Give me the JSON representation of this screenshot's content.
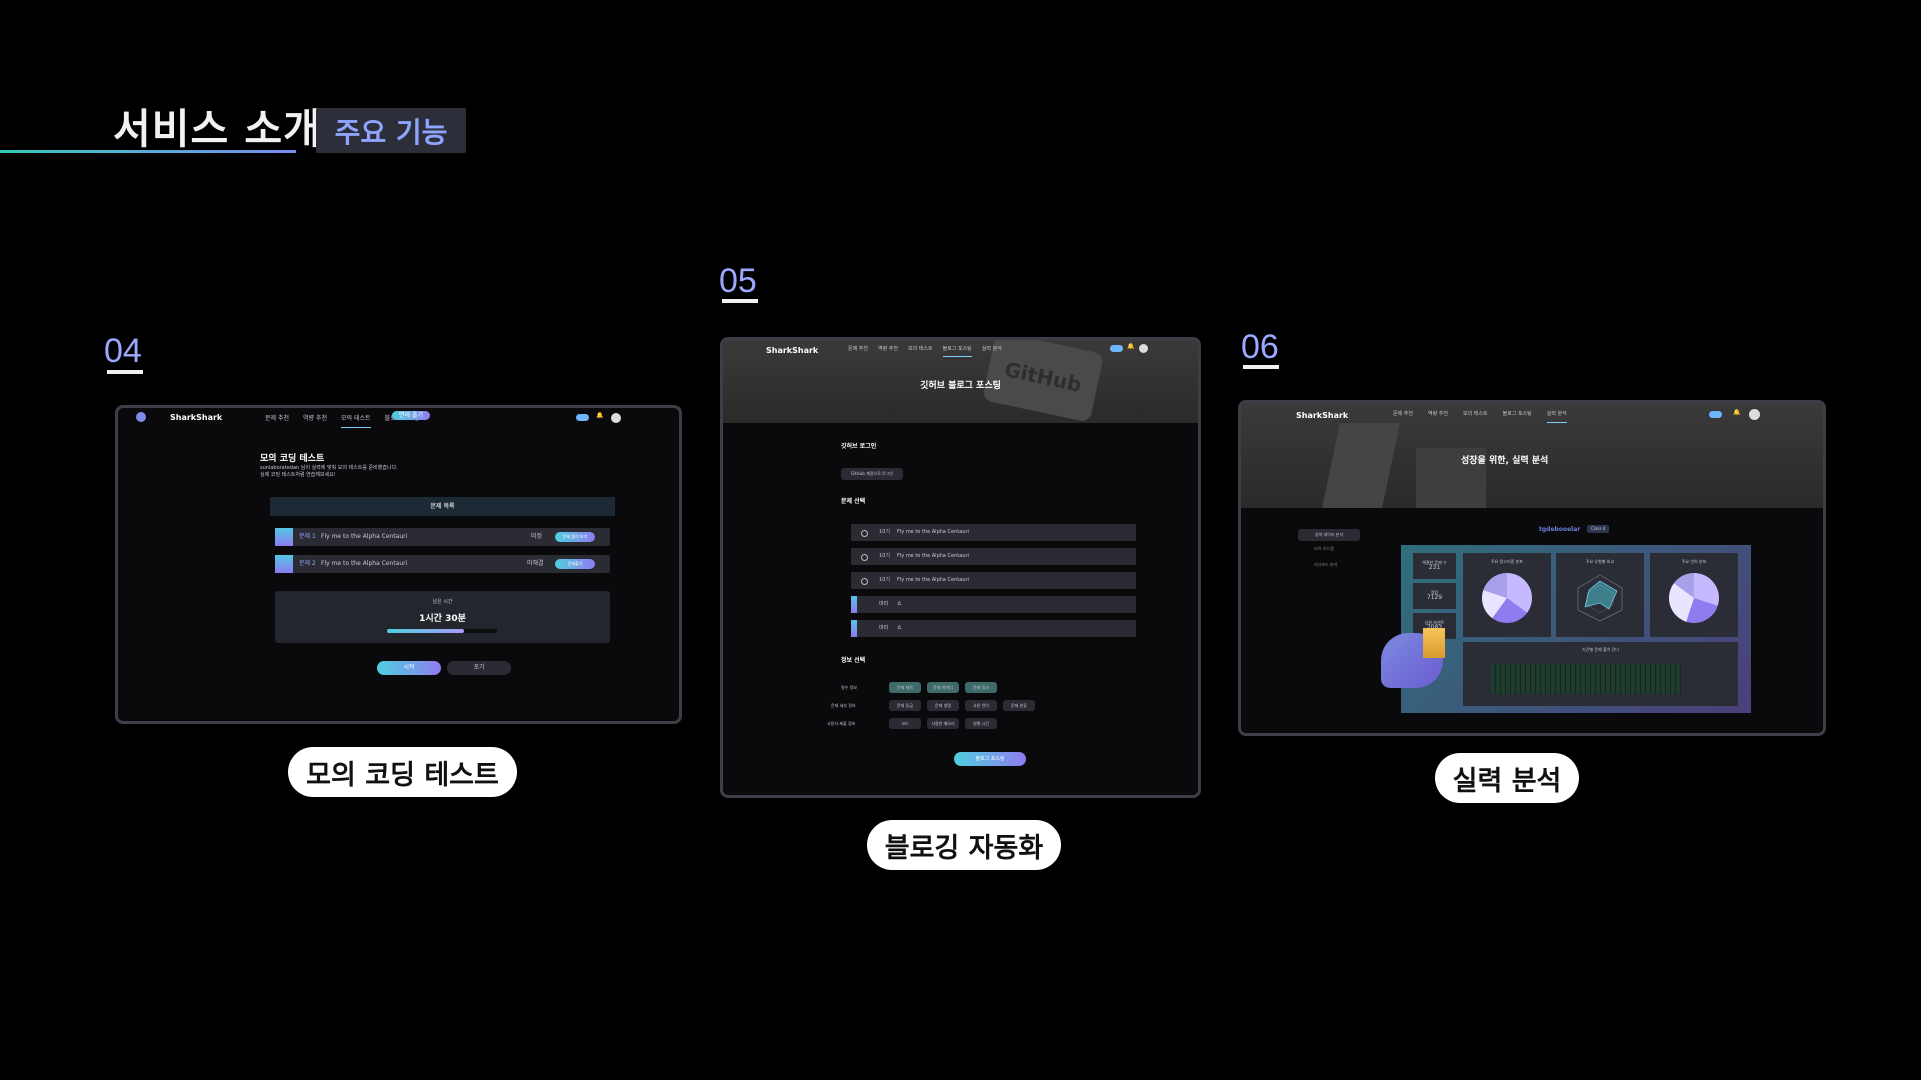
{
  "header": {
    "title": "서비스 소개",
    "badge": "주요 기능"
  },
  "colors": {
    "accent": "#9aa8ff",
    "badge_bg": "#2c2f3a",
    "frame_border": "#3d3f48"
  },
  "features": [
    {
      "number": "04",
      "caption": "모의 코딩 테스트",
      "shot": {
        "logo": "SharkShark",
        "nav": [
          "문제 추천",
          "역량 추천",
          "모의 테스트",
          "블로그 포스팅"
        ],
        "nav_button": "면제 풀기",
        "heading": "모의 코딩 테스트",
        "desc1": "sunlaboratedan 님이 실력에 맞춰 모의 테스트를 준비했습니다.",
        "desc2": "실제 코딩 테스트처럼 연습해보세요!",
        "section": "문제 목록",
        "problems": [
          {
            "label": "문제 1",
            "title": "Fly me to the Alpha Centauri",
            "tag": "미정",
            "button": "문제 풀이 보기"
          },
          {
            "label": "문제 2",
            "title": "Fly me to the Alpha Centauri",
            "tag": "미해결",
            "button": "문제풀기"
          }
        ],
        "timer_label": "남은 시간",
        "timer": "1시간 30분",
        "progress": 0.7,
        "buttons": [
          "시작",
          "포기"
        ]
      }
    },
    {
      "number": "05",
      "caption": "블로깅 자동화",
      "shot": {
        "logo": "SharkShark",
        "nav": [
          "문제 추천",
          "역량 추천",
          "모의 테스트",
          "블로그 포스팅",
          "실력 분석"
        ],
        "hero_title": "깃허브 블로그 포스팅",
        "hero_watermark": "GitHub",
        "login_title": "깃허브 로그인",
        "login_button": "GitHub 계정으로 로그인",
        "select_title": "문제 선택",
        "problems": [
          {
            "tier": "10기",
            "title": "Fly me to the Alpha Centauri"
          },
          {
            "tier": "10기",
            "title": "Fly me to the Alpha Centauri"
          },
          {
            "tier": "10기",
            "title": "Fly me to the Alpha Centauri"
          },
          {
            "tier": "마리",
            "title": "쇼"
          },
          {
            "tier": "마리",
            "title": "쇼"
          }
        ],
        "info_title": "정보 선택",
        "option_rows": [
          {
            "label": "필수 정보",
            "options": [
              "문제 제목",
              "문제 아이디",
              "문제 링크"
            ]
          },
          {
            "label": "문제 세부 정보",
            "options": [
              "문제 등급",
              "문제 설명",
              "사용 언어",
              "문제 분류"
            ]
          },
          {
            "label": "사용자 제출 정보",
            "options": [
              "코드",
              "사용한 메모리",
              "실행 시간"
            ]
          }
        ],
        "submit": "블로그 포스팅"
      }
    },
    {
      "number": "06",
      "caption": "실력 분석",
      "shot": {
        "logo": "SharkShark",
        "nav": [
          "문제 추천",
          "역량 추천",
          "모의 테스트",
          "블로그 포스팅",
          "실력 분석"
        ],
        "hero_title": "성장을 위한, 실력 분석",
        "side_items": [
          "실력 데이터 분석",
          "티어 로드맵",
          "리더보드 분석"
        ],
        "username": "tgdebooelar",
        "user_badge": "Class 4",
        "stats": [
          {
            "label": "해결한 문제 수",
            "value": "231"
          },
          {
            "label": "랭킹",
            "value": "7129"
          },
          {
            "label": "상위 퍼센트",
            "value": "7083"
          }
        ],
        "charts": [
          "주요 알고리즘 분포",
          "주요 유형별 비교",
          "주요 언어 분포"
        ],
        "heatmap_title": "기간별 문제 풀이 잔디"
      }
    }
  ]
}
